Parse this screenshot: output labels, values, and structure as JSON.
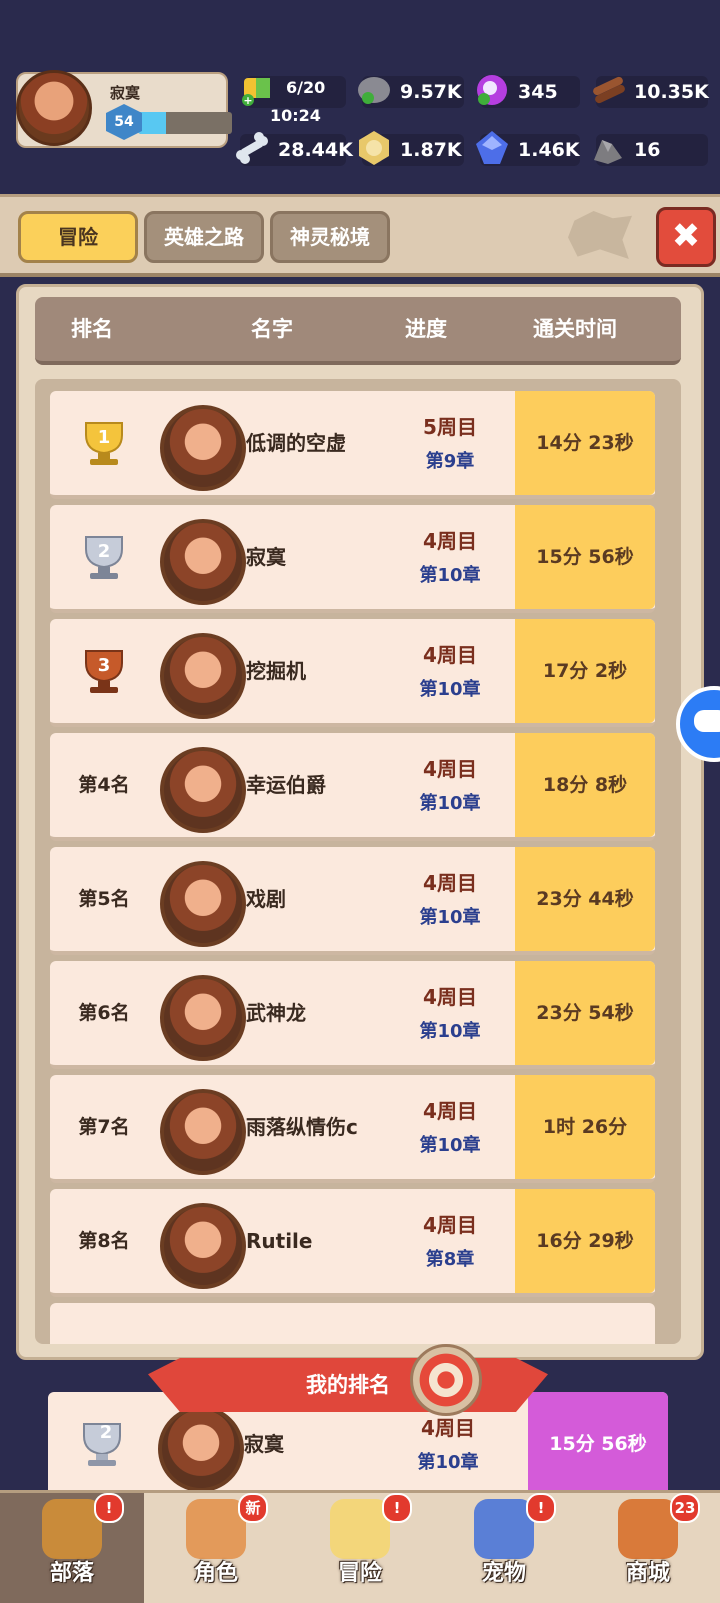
{
  "player": {
    "name": "寂寞",
    "level": "54",
    "xp_fraction": 0.3
  },
  "resources": {
    "energy": {
      "value": "6/20",
      "timer": "10:24"
    },
    "stone": "9.57K",
    "gem_purple": "345",
    "wood": "10.35K",
    "bone": "28.44K",
    "coin": "1.87K",
    "crystal": "1.46K",
    "ore": "16"
  },
  "tabs": [
    {
      "label": "冒险",
      "active": true
    },
    {
      "label": "英雄之路",
      "active": false
    },
    {
      "label": "神灵秘境",
      "active": false
    }
  ],
  "columns": {
    "rank": "排名",
    "name": "名字",
    "progress": "进度",
    "time": "通关时间"
  },
  "rows": [
    {
      "rank": "1",
      "rank_label": "",
      "name": "低调的空虚",
      "cycle": "5周目",
      "chapter": "第9章",
      "time": "14分 23秒"
    },
    {
      "rank": "2",
      "rank_label": "",
      "name": "寂寞",
      "cycle": "4周目",
      "chapter": "第10章",
      "time": "15分 56秒"
    },
    {
      "rank": "3",
      "rank_label": "",
      "name": "挖掘机",
      "cycle": "4周目",
      "chapter": "第10章",
      "time": "17分 2秒"
    },
    {
      "rank": "4",
      "rank_label": "第4名",
      "name": "幸运伯爵",
      "cycle": "4周目",
      "chapter": "第10章",
      "time": "18分 8秒"
    },
    {
      "rank": "5",
      "rank_label": "第5名",
      "name": "戏剧",
      "cycle": "4周目",
      "chapter": "第10章",
      "time": "23分 44秒"
    },
    {
      "rank": "6",
      "rank_label": "第6名",
      "name": "武神龙",
      "cycle": "4周目",
      "chapter": "第10章",
      "time": "23分 54秒"
    },
    {
      "rank": "7",
      "rank_label": "第7名",
      "name": "雨落纵情伤c",
      "cycle": "4周目",
      "chapter": "第10章",
      "time": "1时 26分"
    },
    {
      "rank": "8",
      "rank_label": "第8名",
      "name": "Rutile",
      "cycle": "4周目",
      "chapter": "第8章",
      "time": "16分 29秒"
    }
  ],
  "my_rank": {
    "title": "我的排名",
    "rank": "2",
    "name": "寂寞",
    "cycle": "4周目",
    "chapter": "第10章",
    "time": "15分 56秒"
  },
  "nav": [
    {
      "label": "部落",
      "icon": "tribe-icon",
      "badge": "!",
      "active": true
    },
    {
      "label": "角色",
      "icon": "character-icon",
      "badge": "新",
      "active": false
    },
    {
      "label": "冒险",
      "icon": "adventure-map-icon",
      "badge": "!",
      "active": false
    },
    {
      "label": "宠物",
      "icon": "pet-icon",
      "badge": "!",
      "active": false
    },
    {
      "label": "商城",
      "icon": "shop-icon",
      "badge": "23",
      "active": false
    }
  ],
  "colors": {
    "gold": "#fdcd5c",
    "self_highlight": "#d45bd9",
    "tab_active": "#fbd05a",
    "close": "#e24c3c"
  }
}
